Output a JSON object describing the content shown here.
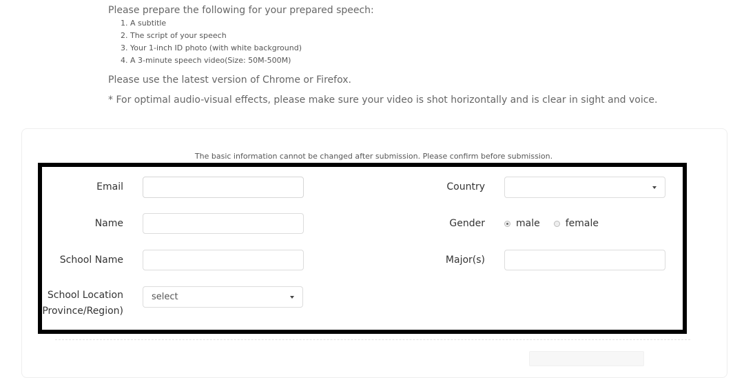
{
  "intro": {
    "title": "Please prepare the following for your prepared speech:",
    "items": [
      "1. A subtitle",
      "2. The script of your speech",
      "3. Your 1-inch ID photo (with white background)",
      "4. A 3-minute speech video(Size: 50M-500M)"
    ],
    "browser_note": "Please use the latest version of Chrome or Firefox.",
    "av_note": "* For optimal audio-visual effects, please make sure your video is shot horizontally and is clear in sight and voice."
  },
  "form": {
    "notice": "The basic information cannot be changed after submission. Please confirm before submission.",
    "email": {
      "label": "Email",
      "value": "",
      "placeholder": ""
    },
    "name": {
      "label": "Name",
      "value": "",
      "placeholder": ""
    },
    "school_name": {
      "label": "School Name",
      "value": "",
      "placeholder": ""
    },
    "school_location": {
      "label_line1": "School Location",
      "label_line2": "Province/Region)",
      "selected": "select"
    },
    "country": {
      "label": "Country",
      "selected": ""
    },
    "gender": {
      "label": "Gender",
      "options": [
        {
          "label": "male",
          "checked": true
        },
        {
          "label": "female",
          "checked": false
        }
      ]
    },
    "majors": {
      "label": "Major(s)",
      "value": "",
      "placeholder": ""
    }
  }
}
